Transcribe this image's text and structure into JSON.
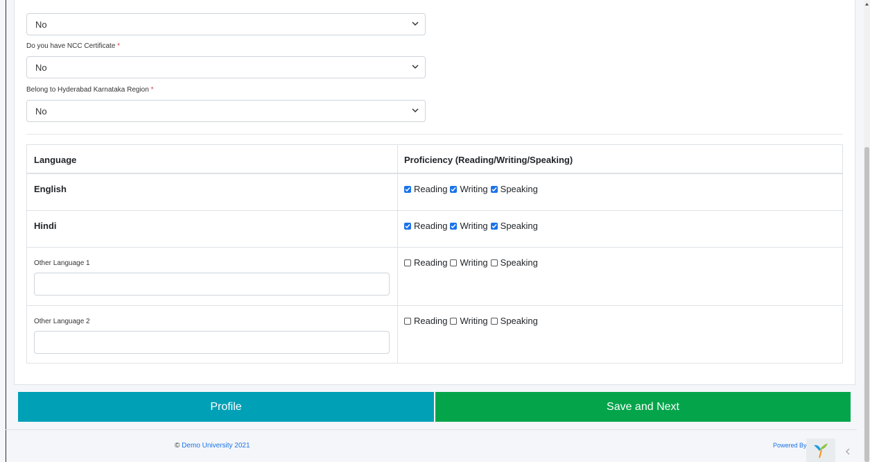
{
  "selects": [
    {
      "label": "",
      "value": "No"
    },
    {
      "label": "Do you have NCC Certificate",
      "required": "*",
      "value": "No"
    },
    {
      "label": "Belong to Hyderabad Karnataka Region",
      "required": "*",
      "value": "No"
    }
  ],
  "table": {
    "headers": [
      "Language",
      "Proficiency (Reading/Writing/Speaking)"
    ],
    "rows": [
      {
        "name": "English",
        "reading": "Reading",
        "writing": "Writing",
        "speaking": "Speaking"
      },
      {
        "name": "Hindi",
        "reading": "Reading",
        "writing": "Writing",
        "speaking": "Speaking"
      },
      {
        "label": "Other Language 1",
        "value": "",
        "reading": "Reading",
        "writing": "Writing",
        "speaking": "Speaking"
      },
      {
        "label": "Other Language 2",
        "value": "",
        "reading": "Reading",
        "writing": "Writing",
        "speaking": "Speaking"
      }
    ]
  },
  "buttons": {
    "profile": "Profile",
    "save": "Save and Next"
  },
  "footer": {
    "copyright_symbol": "©",
    "copyright_link": "Demo University 2021",
    "powered_by": "Powered By:"
  },
  "colors": {
    "profile_button": "#00a0b6",
    "save_button": "#04a54a",
    "checkbox": "#1a73e8",
    "required": "#dc3545"
  },
  "icons": {
    "select_arrow": "chevron-down-icon",
    "checked": "checkbox-checked-icon",
    "unchecked": "checkbox-unchecked-icon",
    "brand": "yii-logo-icon"
  }
}
